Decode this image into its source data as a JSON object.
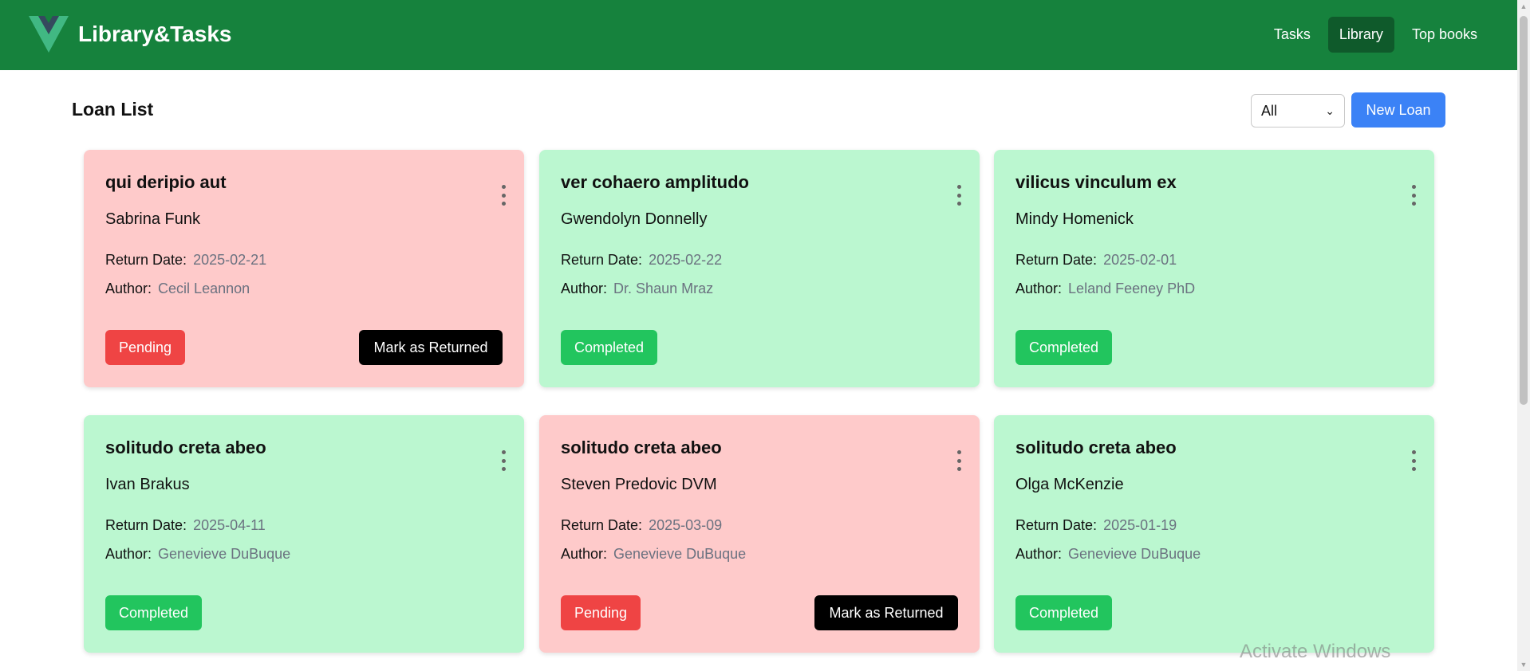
{
  "app": {
    "brand": "Library&Tasks",
    "logo_icon": "vue-logo-icon"
  },
  "nav": {
    "items": [
      {
        "label": "Tasks",
        "active": false
      },
      {
        "label": "Library",
        "active": true
      },
      {
        "label": "Top books",
        "active": false
      }
    ]
  },
  "page": {
    "title": "Loan List",
    "filter_value": "All",
    "new_button": "New Loan"
  },
  "labels": {
    "return_date": "Return Date:",
    "author": "Author:",
    "mark_returned": "Mark as Returned"
  },
  "loans": [
    {
      "title": "qui deripio aut",
      "borrower": "Sabrina Funk",
      "return_date": "2025-02-21",
      "author": "Cecil Leannon",
      "status": "Pending"
    },
    {
      "title": "ver cohaero amplitudo",
      "borrower": "Gwendolyn Donnelly",
      "return_date": "2025-02-22",
      "author": "Dr. Shaun Mraz",
      "status": "Completed"
    },
    {
      "title": "vilicus vinculum ex",
      "borrower": "Mindy Homenick",
      "return_date": "2025-02-01",
      "author": "Leland Feeney PhD",
      "status": "Completed"
    },
    {
      "title": "solitudo creta abeo",
      "borrower": "Ivan Brakus",
      "return_date": "2025-04-11",
      "author": "Genevieve DuBuque",
      "status": "Completed"
    },
    {
      "title": "solitudo creta abeo",
      "borrower": "Steven Predovic DVM",
      "return_date": "2025-03-09",
      "author": "Genevieve DuBuque",
      "status": "Pending"
    },
    {
      "title": "solitudo creta abeo",
      "borrower": "Olga McKenzie",
      "return_date": "2025-01-19",
      "author": "Genevieve DuBuque",
      "status": "Completed"
    }
  ],
  "colors": {
    "navbar": "#16823d",
    "nav_active": "#0f5a2b",
    "pending_card": "#fecaca",
    "completed_card": "#bbf7d0",
    "pending_badge": "#ef4444",
    "completed_badge": "#22c55e",
    "primary_button": "#3b82f6"
  },
  "watermark": "Activate Windows"
}
